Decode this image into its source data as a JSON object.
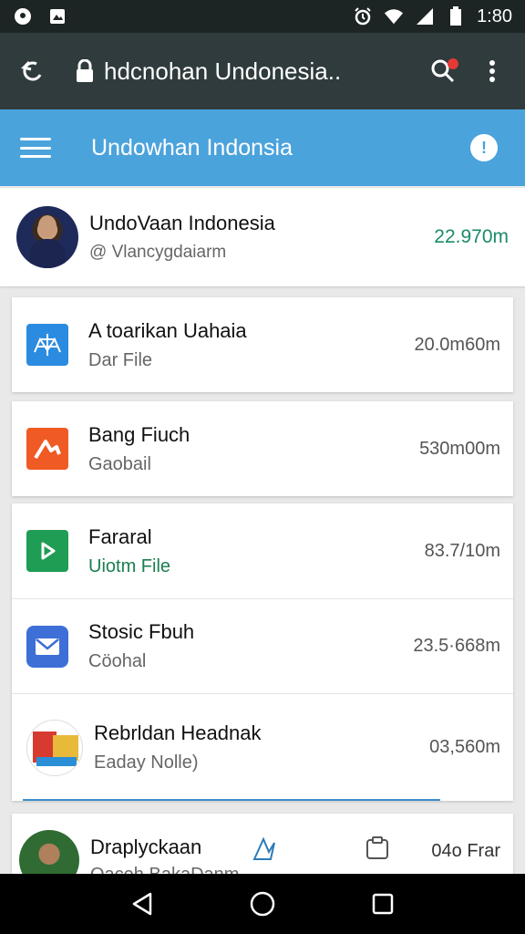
{
  "status_bar": {
    "time": "1:80",
    "icons": [
      "notification-icon",
      "gallery-icon",
      "alarm-icon",
      "wifi-icon",
      "signal-icon",
      "battery-icon"
    ]
  },
  "toolbar": {
    "title": "hdcnohan Undonesia..",
    "icons": [
      "back-icon",
      "lock-icon",
      "search-icon",
      "more-icon"
    ]
  },
  "header": {
    "title": "Undowhan Indonsia",
    "icons": [
      "menu-icon",
      "alert-icon"
    ],
    "alert_glyph": "!"
  },
  "profile": {
    "name": "UndoVaan Indonesia",
    "handle": "@ Vlancygdaiarm",
    "value": "22.970m"
  },
  "items": [
    {
      "title": "A toarikan Uahaia",
      "subtitle": "Dar File",
      "value": "20.0m60m",
      "icon": "network-icon",
      "color": "#2b8be0"
    },
    {
      "title": "Bang Fiuch",
      "subtitle": "Gaobail",
      "value": "530m00m",
      "icon": "music-icon",
      "color": "#f05a24"
    },
    {
      "title": "Fararal",
      "subtitle": "Uiotm File",
      "value": "83.7/10m",
      "icon": "play-icon",
      "color": "#1f9d55",
      "subtitle_color": "#1a7f4f"
    },
    {
      "title": "Stosic Fbuh",
      "subtitle": "Cöohal",
      "value": "23.5·668m",
      "icon": "mail-icon",
      "color": "#3d6fd6"
    },
    {
      "title": "Rebrldan Headnak",
      "subtitle": "Eaday Nolle)",
      "value": "03,560m",
      "icon": "news-thumbnail"
    }
  ],
  "last_item": {
    "title": "Draplyckaan",
    "subtitle": "Oaceh BakaDanm",
    "value": "04o Frar",
    "icons": [
      "pen-icon",
      "clipboard-icon"
    ]
  },
  "nav_bar": {
    "icons": [
      "back-triangle-icon",
      "home-circle-icon",
      "recents-square-icon"
    ]
  }
}
